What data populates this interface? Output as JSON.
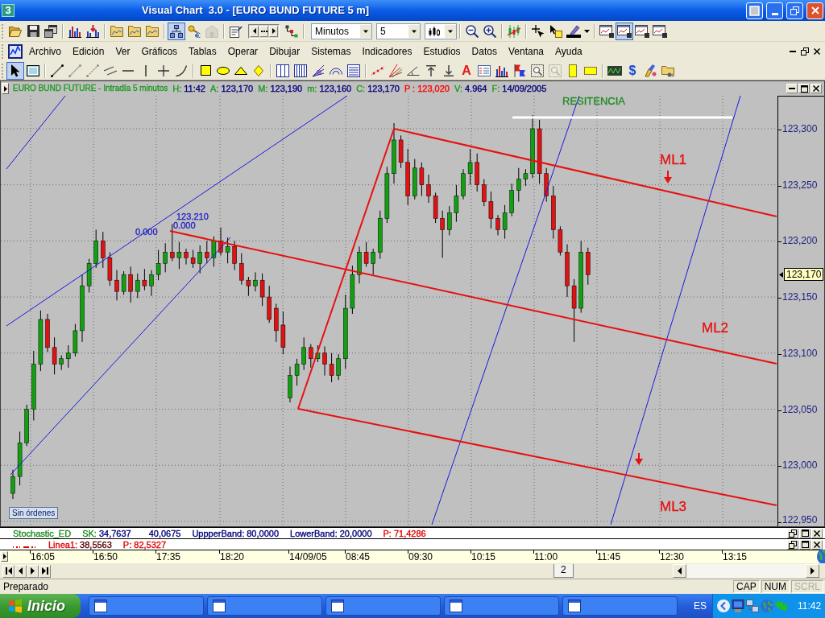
{
  "window": {
    "app_icon": "3",
    "title": "Visual Chart  3.0 - [EURO BUND FUTURE 5 m]"
  },
  "toolbar_1": {
    "groups": [
      [
        {
          "kind": "button",
          "selected": false,
          "disabled": false
        },
        {
          "kind": "button",
          "selected": false,
          "disabled": false
        },
        {
          "kind": "button",
          "selected": false,
          "disabled": false
        }
      ],
      [
        {
          "kind": "button",
          "selected": false,
          "disabled": false
        },
        {
          "kind": "button",
          "selected": false,
          "disabled": false
        }
      ],
      [
        {
          "kind": "button",
          "selected": false,
          "disabled": false
        },
        {
          "kind": "button",
          "selected": false,
          "disabled": false
        },
        {
          "kind": "button",
          "selected": false,
          "disabled": false
        }
      ],
      [
        {
          "kind": "button",
          "selected": true,
          "disabled": false
        },
        {
          "kind": "button",
          "selected": false,
          "disabled": false
        },
        {
          "kind": "button",
          "selected": false,
          "disabled": true
        }
      ],
      [
        {
          "kind": "button",
          "selected": false,
          "disabled": false
        },
        {
          "kind": "pager"
        },
        {
          "kind": "button",
          "selected": false,
          "disabled": false
        }
      ],
      [
        {
          "kind": "dropdown",
          "value": "Minutos"
        },
        {
          "kind": "dropdown",
          "value": "5"
        },
        {
          "kind": "icon_dropdown"
        }
      ],
      [
        {
          "kind": "button",
          "selected": false,
          "disabled": false
        },
        {
          "kind": "button",
          "selected": false,
          "disabled": false
        }
      ],
      [
        {
          "kind": "button",
          "selected": false,
          "disabled": false
        }
      ],
      [
        {
          "kind": "button",
          "selected": false,
          "disabled": false
        },
        {
          "kind": "button",
          "selected": false,
          "disabled": false
        },
        {
          "kind": "split_button",
          "selected": false
        }
      ],
      [
        {
          "kind": "button",
          "selected": false,
          "disabled": false
        },
        {
          "kind": "button",
          "selected": true,
          "disabled": false
        },
        {
          "kind": "button",
          "selected": false,
          "disabled": false
        },
        {
          "kind": "button",
          "selected": false,
          "disabled": false
        }
      ]
    ]
  },
  "menu_bar": {
    "items": [
      "Archivo",
      "Edición",
      "Ver",
      "Gráficos",
      "Tablas",
      "Operar",
      "Dibujar",
      "Sistemas",
      "Indicadores",
      "Estudios",
      "Datos",
      "Ventana",
      "Ayuda"
    ]
  },
  "toolbar_2": {
    "groups": [
      [
        {
          "kind": "button",
          "selected": true,
          "disabled": false
        },
        {
          "kind": "button",
          "selected": false,
          "disabled": false
        }
      ],
      [
        {
          "kind": "button",
          "selected": false,
          "disabled": false
        },
        {
          "kind": "button",
          "selected": false,
          "disabled": false
        },
        {
          "kind": "button",
          "selected": false,
          "disabled": false
        },
        {
          "kind": "button",
          "selected": false,
          "disabled": false
        },
        {
          "kind": "button",
          "selected": false,
          "disabled": false
        },
        {
          "kind": "button",
          "selected": false,
          "disabled": false
        },
        {
          "kind": "button",
          "selected": false,
          "disabled": false
        },
        {
          "kind": "button",
          "selected": false,
          "disabled": false
        }
      ],
      [
        {
          "kind": "button",
          "selected": false,
          "disabled": false
        },
        {
          "kind": "button",
          "selected": false,
          "disabled": false
        },
        {
          "kind": "button",
          "selected": false,
          "disabled": false
        },
        {
          "kind": "button",
          "selected": false,
          "disabled": false
        }
      ],
      [
        {
          "kind": "button",
          "selected": false,
          "disabled": false
        },
        {
          "kind": "button",
          "selected": false,
          "disabled": false
        },
        {
          "kind": "button",
          "selected": false,
          "disabled": false
        },
        {
          "kind": "button",
          "selected": false,
          "disabled": false
        },
        {
          "kind": "button",
          "selected": false,
          "disabled": false
        }
      ],
      [
        {
          "kind": "button",
          "selected": false,
          "disabled": false
        },
        {
          "kind": "button",
          "selected": false,
          "disabled": false
        },
        {
          "kind": "button",
          "selected": false,
          "disabled": false
        },
        {
          "kind": "button",
          "selected": false,
          "disabled": false
        },
        {
          "kind": "button",
          "selected": false,
          "disabled": false
        },
        {
          "kind": "glyph_button",
          "glyph": "A",
          "color": "#e81818"
        },
        {
          "kind": "button",
          "selected": false,
          "disabled": false
        },
        {
          "kind": "button",
          "selected": false,
          "disabled": false
        },
        {
          "kind": "button",
          "selected": false,
          "disabled": false
        },
        {
          "kind": "button",
          "selected": false,
          "disabled": false
        },
        {
          "kind": "button",
          "selected": false,
          "disabled": true
        },
        {
          "kind": "button",
          "selected": false,
          "disabled": false
        },
        {
          "kind": "button",
          "selected": false,
          "disabled": false
        }
      ],
      [
        {
          "kind": "button",
          "selected": false,
          "disabled": false
        },
        {
          "kind": "glyph_button",
          "glyph": "$",
          "color": "#1848e0"
        },
        {
          "kind": "button",
          "selected": false,
          "disabled": false
        },
        {
          "kind": "button",
          "selected": false,
          "disabled": false
        }
      ]
    ]
  },
  "chart_window": {
    "title": {
      "text": "EURO BUND FUTURE - Intradía 5 minutos",
      "color": "#1f9a1f"
    },
    "fields": [
      {
        "label": {
          "text": "H:",
          "color": "#1f9a1f"
        },
        "value": {
          "text": "11:42",
          "color": "#00007a"
        }
      },
      {
        "label": {
          "text": "A:",
          "color": "#1f9a1f"
        },
        "value": {
          "text": "123,170",
          "color": "#00007a"
        }
      },
      {
        "label": {
          "text": "M:",
          "color": "#1f9a1f"
        },
        "value": {
          "text": "123,190",
          "color": "#00007a"
        }
      },
      {
        "label": {
          "text": "m:",
          "color": "#1f9a1f"
        },
        "value": {
          "text": "123,160",
          "color": "#00007a"
        }
      },
      {
        "label": {
          "text": "C:",
          "color": "#1f9a1f"
        },
        "value": {
          "text": "123,170",
          "color": "#00007a"
        }
      },
      {
        "label": {
          "text": "P :",
          "color": "#ff0000"
        },
        "value": {
          "text": "123,020",
          "color": "#ff0000"
        }
      },
      {
        "label": {
          "text": "V:",
          "color": "#1f9a1f"
        },
        "value": {
          "text": "4.964",
          "color": "#00007a"
        }
      },
      {
        "label": {
          "text": "F:",
          "color": "#1f9a1f"
        },
        "value": {
          "text": "14/09/2005",
          "color": "#00007a"
        }
      }
    ],
    "drawing_labels": [
      {
        "text": "RESITENCIA",
        "color": "#1e8a1e"
      },
      {
        "text": "0.000",
        "color": "#2020c8"
      },
      {
        "text": "123.210",
        "color": "#2020c8"
      },
      {
        "text": "0.000",
        "color": "#2020c8"
      },
      {
        "text": "ML1",
        "color": "#e81010"
      },
      {
        "text": "ML2",
        "color": "#e81010"
      },
      {
        "text": "ML3",
        "color": "#e81010"
      }
    ],
    "order_status": "Sin órdenes",
    "price_axis": [
      "123,300",
      "123,250",
      "123,200",
      "123,150",
      "123,100",
      "123,050",
      "123,000",
      "122,950"
    ],
    "last_price": "123,170"
  },
  "indicator_panels": [
    {
      "name": "Stochastic_ED",
      "color": "#1f8a1f",
      "fields": [
        {
          "label": {
            "text": "SK:",
            "color": "#1f8a1f"
          },
          "value": {
            "text": "34,7637",
            "color": "#00007a"
          }
        },
        {
          "value": {
            "text": "40,0675",
            "color": "#00007a"
          }
        },
        {
          "label": {
            "text": "UppperBand:",
            "color": "#00007a"
          },
          "value": {
            "text": "80,0000",
            "color": "#00007a"
          }
        },
        {
          "label": {
            "text": "LowerBand:",
            "color": "#00007a"
          },
          "value": {
            "text": "20,0000",
            "color": "#00007a"
          }
        },
        {
          "label": {
            "text": "P:",
            "color": "#e00000"
          },
          "value": {
            "text": "71,4286",
            "color": "#e00000"
          }
        }
      ]
    },
    {
      "color": "#e00000",
      "fields": [
        {
          "label": {
            "text": "Linea1:",
            "color": "#e00000"
          },
          "value": {
            "text": "38,5563",
            "color": "#5a0000"
          }
        },
        {
          "label": {
            "text": "P:",
            "color": "#e00000"
          },
          "value": {
            "text": "82,5327",
            "color": "#e00000"
          }
        }
      ]
    }
  ],
  "time_axis": [
    "16:05",
    "16:50",
    "17:35",
    "18:20",
    "14/09/05",
    "08:45",
    "09:30",
    "10:15",
    "11:00",
    "11:45",
    "12:30",
    "13:15"
  ],
  "sheet_tabs": [
    {
      "label": "2"
    }
  ],
  "status_bar": {
    "text": "Preparado",
    "indicators": [
      {
        "label": "CAP",
        "on": true
      },
      {
        "label": "NUM",
        "on": true
      },
      {
        "label": "SCRL",
        "on": false
      }
    ]
  },
  "taskbar": {
    "start_button": "Inicio",
    "language": "ES",
    "clock": "11:42"
  }
}
